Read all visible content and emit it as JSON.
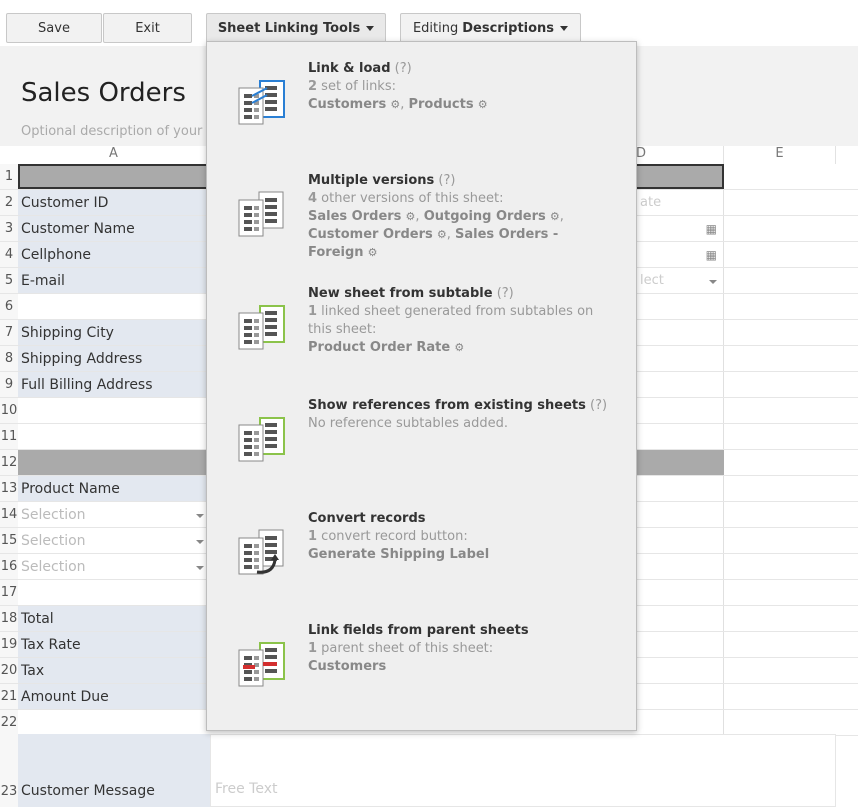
{
  "toolbar": {
    "save": "Save",
    "exit": "Exit",
    "linking_tools": "Sheet Linking Tools",
    "editing_prefix": "Editing",
    "editing_bold": "Descriptions"
  },
  "sheet": {
    "title": "Sales Orders",
    "description_placeholder": "Optional description of your",
    "columns": [
      "A",
      "D",
      "E"
    ],
    "rows": [
      {
        "n": "1",
        "text": "",
        "kind": "section"
      },
      {
        "n": "2",
        "text": "Customer ID",
        "kind": "label",
        "right": "ate"
      },
      {
        "n": "3",
        "text": "Customer Name",
        "kind": "label"
      },
      {
        "n": "4",
        "text": "Cellphone",
        "kind": "label"
      },
      {
        "n": "5",
        "text": "E-mail",
        "kind": "label",
        "right": "lect"
      },
      {
        "n": "6",
        "text": "",
        "kind": "blank"
      },
      {
        "n": "7",
        "text": "Shipping City",
        "kind": "label"
      },
      {
        "n": "8",
        "text": "Shipping Address",
        "kind": "label"
      },
      {
        "n": "9",
        "text": "Full Billing Address",
        "kind": "label"
      },
      {
        "n": "10",
        "text": "",
        "kind": "blank"
      },
      {
        "n": "11",
        "text": "",
        "kind": "blank"
      },
      {
        "n": "12",
        "text": "",
        "kind": "section"
      },
      {
        "n": "13",
        "text": "Product Name",
        "kind": "label"
      },
      {
        "n": "14",
        "text": "Selection",
        "kind": "select"
      },
      {
        "n": "15",
        "text": "Selection",
        "kind": "select"
      },
      {
        "n": "16",
        "text": "Selection",
        "kind": "select"
      },
      {
        "n": "17",
        "text": "",
        "kind": "blank"
      },
      {
        "n": "18",
        "text": "Total",
        "kind": "label"
      },
      {
        "n": "19",
        "text": "Tax Rate",
        "kind": "label"
      },
      {
        "n": "20",
        "text": "Tax",
        "kind": "label"
      },
      {
        "n": "21",
        "text": "Amount Due",
        "kind": "label"
      },
      {
        "n": "22",
        "text": "",
        "kind": "blank"
      }
    ],
    "message_row": {
      "n": "23",
      "label": "Customer Message",
      "placeholder": "Free Text"
    }
  },
  "menu": {
    "items": [
      {
        "title": "Link & load",
        "help": "(?)",
        "count": "2",
        "desc": " set of links:",
        "links": [
          "Customers",
          "Products"
        ],
        "icon": "link-load-icon"
      },
      {
        "title": "Multiple versions",
        "help": "(?)",
        "count": "4",
        "desc": " other versions of this sheet:",
        "links": [
          "Sales Orders",
          "Outgoing Orders",
          "Customer Orders",
          "Sales Orders - Foreign"
        ],
        "icon": "multiple-versions-icon"
      },
      {
        "title": "New sheet from subtable",
        "help": "(?)",
        "count": "1",
        "desc": " linked sheet generated from subtables on this sheet:",
        "links": [
          "Product Order Rate"
        ],
        "icon": "subtable-sheet-icon"
      },
      {
        "title": "Show references from existing sheets",
        "help": "(?)",
        "count": "",
        "desc": "No reference subtables added.",
        "links": [],
        "icon": "references-icon"
      },
      {
        "title": "Convert records",
        "help": "",
        "count": "1",
        "desc": " convert record button:",
        "links": [
          "Generate Shipping Label"
        ],
        "icon": "convert-records-icon"
      },
      {
        "title": "Link fields from parent sheets",
        "help": "",
        "count": "1",
        "desc": " parent sheet of this sheet:",
        "links": [
          "Customers"
        ],
        "icon": "parent-sheets-icon"
      }
    ]
  },
  "colors": {
    "label_bg": "#e3e8f0",
    "section_bg": "#aaaaaa",
    "accent_green": "#8bc34a",
    "accent_blue": "#2a7fd4",
    "accent_red": "#d32f2f"
  }
}
